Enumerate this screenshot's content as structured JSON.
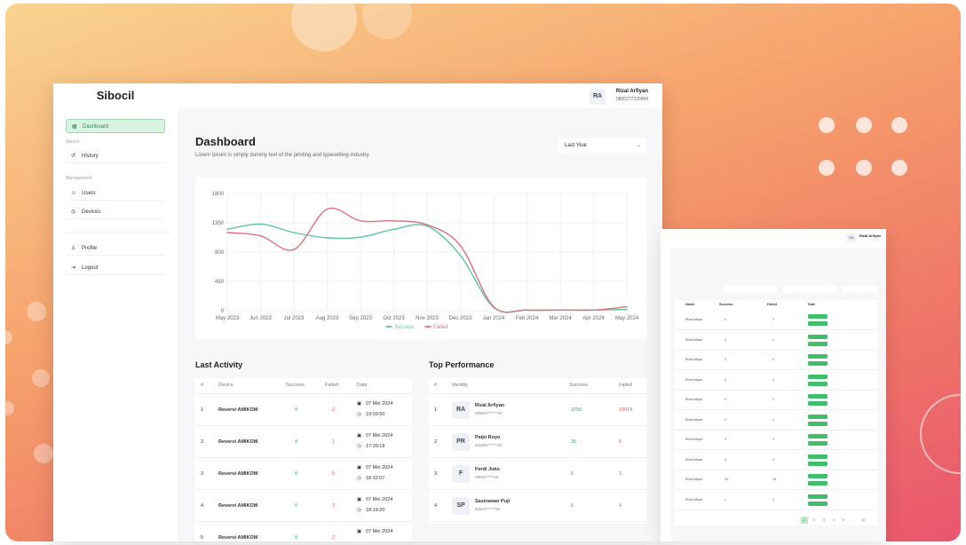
{
  "brand": "Sibocil",
  "user": {
    "initials": "RA",
    "name": "Rizal Arfiyan",
    "phone": "0895277220994"
  },
  "sidebar": {
    "items": [
      {
        "label": "Dashboard",
        "icon": "grid-icon",
        "active": true
      },
      {
        "section": "Sibocil"
      },
      {
        "label": "History",
        "icon": "history-icon"
      },
      {
        "section": "Management"
      },
      {
        "label": "Users",
        "icon": "users-icon"
      },
      {
        "label": "Devices",
        "icon": "devices-icon"
      },
      {
        "label": "Profile",
        "icon": "profile-icon"
      },
      {
        "label": "Logout",
        "icon": "logout-icon"
      }
    ]
  },
  "page": {
    "title": "Dashboard",
    "subtitle": "Lorem Ipsum is simply dummy text of the printing and typesetting industry.",
    "period_select": "Last Year"
  },
  "chart_data": {
    "type": "line",
    "x": [
      "May 2023",
      "Jun 2023",
      "Jul 2023",
      "Aug 2023",
      "Sep 2023",
      "Oct 2023",
      "Nov 2023",
      "Dec 2023",
      "Jan 2024",
      "Feb 2024",
      "Mar 2024",
      "Apr 2024",
      "May 2024"
    ],
    "ylim": [
      0,
      1800
    ],
    "yticks": [
      "1800",
      "1350",
      "900",
      "450",
      "0"
    ],
    "series": [
      {
        "name": "Success",
        "color": "#5cc4a4",
        "values": [
          1250,
          1330,
          1200,
          1120,
          1130,
          1250,
          1300,
          850,
          50,
          10,
          10,
          10,
          20
        ]
      },
      {
        "name": "Failed",
        "color": "#e0707a",
        "values": [
          1200,
          1150,
          940,
          1560,
          1380,
          1380,
          1320,
          1000,
          60,
          10,
          10,
          10,
          60
        ]
      }
    ]
  },
  "last_activity": {
    "title": "Last Activity",
    "columns": [
      "#",
      "Device",
      "Success",
      "Failed",
      "Date"
    ],
    "rows": [
      {
        "num": "1",
        "device": "Reverst AMIKOM",
        "success": "4",
        "failed": "2",
        "date": "07 Mei 2024",
        "time": "19:09:50"
      },
      {
        "num": "2",
        "device": "Reverst AMIKOM",
        "success": "4",
        "failed": "1",
        "date": "07 Mei 2024",
        "time": "17:39:18"
      },
      {
        "num": "3",
        "device": "Reverst AMIKOM",
        "success": "0",
        "failed": "5",
        "date": "07 Mei 2024",
        "time": "18:32:07"
      },
      {
        "num": "4",
        "device": "Reverst AMIKOM",
        "success": "0",
        "failed": "3",
        "date": "07 Mei 2024",
        "time": "18:19:20"
      },
      {
        "num": "5",
        "device": "Reverst AMIKOM",
        "success": "0",
        "failed": "2",
        "date": "07 Mei 2024",
        "time": ""
      }
    ]
  },
  "top_performance": {
    "title": "Top Performance",
    "columns": [
      "#",
      "Identity",
      "Success",
      "Failed"
    ],
    "rows": [
      {
        "num": "1",
        "initials": "RA",
        "name": "Rizal Arfiyan",
        "phone": "089527******94",
        "success": "3750",
        "failed": "10014"
      },
      {
        "num": "2",
        "initials": "PR",
        "name": "Paijo Royo",
        "phone": "625891******32",
        "success": "35",
        "failed": "6"
      },
      {
        "num": "3",
        "initials": "F",
        "name": "Ferdi Joko",
        "phone": "08051*****18",
        "success": "6",
        "failed": "3"
      },
      {
        "num": "4",
        "initials": "SP",
        "name": "Sastrawan Puji",
        "phone": "62823******55",
        "success": "5",
        "failed": "4"
      }
    ]
  },
  "secondary": {
    "user_name": "Rizal Arfiyan",
    "columns": [
      "Name",
      "Success",
      "Failed",
      "Date"
    ],
    "rows": [
      {
        "name": "Rizal Arfiyan",
        "success": "4",
        "failed": "2"
      },
      {
        "name": "Rizal Arfiyan",
        "success": "4",
        "failed": "1"
      },
      {
        "name": "Rizal Arfiyan",
        "success": "0",
        "failed": "5"
      },
      {
        "name": "Rizal Arfiyan",
        "success": "0",
        "failed": "3"
      },
      {
        "name": "Rizal Arfiyan",
        "success": "0",
        "failed": "2"
      },
      {
        "name": "Rizal Arfiyan",
        "success": "0",
        "failed": "4"
      },
      {
        "name": "Rizal Arfiyan",
        "success": "0",
        "failed": "3"
      },
      {
        "name": "Rizal Arfiyan",
        "success": "0",
        "failed": "3"
      },
      {
        "name": "Rizal Arfiyan",
        "success": "10",
        "failed": "18"
      },
      {
        "name": "Rizal Arfiyan",
        "success": "1",
        "failed": "3"
      }
    ],
    "pages": [
      "1",
      "2",
      "3",
      "4",
      "5",
      "...",
      "10"
    ]
  }
}
